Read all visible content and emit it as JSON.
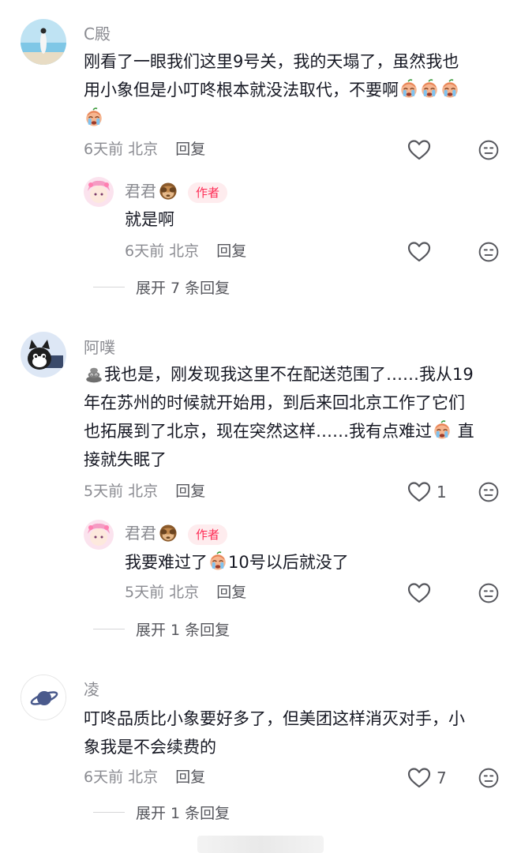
{
  "comments": [
    {
      "username": "C殿",
      "text_lines": [
        "刚看了一眼我们这里9号关，我的天塌了，虽然我也",
        "用小象但是小叮咚根本就没法取代，不要啊"
      ],
      "time": "6天前",
      "location": "北京",
      "reply_label": "回复",
      "like_count": "",
      "reply": {
        "username": "君君",
        "badge": "作者",
        "text": "就是啊",
        "time": "6天前",
        "location": "北京",
        "reply_label": "回复",
        "like_count": ""
      },
      "expand_label": "展开 7 条回复"
    },
    {
      "username": "阿噗",
      "text_lines": [
        "我也是，刚发现我这里不在配送范围了……我从19",
        "年在苏州的时候就开始用，到后来回北京工作了它们",
        "也拓展到了北京，现在突然这样……我有点难过",
        "接就失眠了"
      ],
      "text_tail": " 直",
      "time": "5天前",
      "location": "北京",
      "reply_label": "回复",
      "like_count": "1",
      "reply": {
        "username": "君君",
        "badge": "作者",
        "text_before": "我要难过了",
        "text_after": "10号以后就没了",
        "time": "5天前",
        "location": "北京",
        "reply_label": "回复",
        "like_count": ""
      },
      "expand_label": "展开 1 条回复"
    },
    {
      "username": "凌",
      "text_lines": [
        "叮咚品质比小象要好多了，但美团这样消灭对手，小",
        "象我是不会续费的"
      ],
      "time": "6天前",
      "location": "北京",
      "reply_label": "回复",
      "like_count": "7",
      "expand_label": "展开 1 条回复"
    }
  ],
  "icons": {
    "like": "heart-outline-icon",
    "dislike": "neutral-face-icon",
    "crying": "crying-face-emoji",
    "monkey": "see-no-evil-monkey-emoji",
    "poop": "poop-emoji"
  },
  "colors": {
    "badge_text": "#fe2c55",
    "badge_bg": "#feecee",
    "meta": "#8a8b91"
  }
}
